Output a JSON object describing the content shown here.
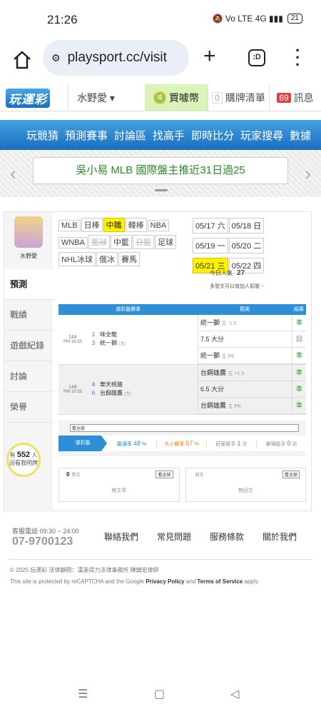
{
  "status": {
    "time": "21:26",
    "icons": "🔕 Vo LTE 4G ▮▮▮",
    "battery": "21"
  },
  "browser": {
    "url": "playsport.cc/visit",
    "tabs_label": ":D"
  },
  "site": {
    "logo": "玩運彩",
    "user": "水野愛 ▾",
    "buy": "買噱幣",
    "cart_count": "0",
    "cart": "購牌清單",
    "msg_count": "69",
    "msg": "訊息"
  },
  "nav": [
    "玩競猜",
    "預測賽事",
    "討論區",
    "找高手",
    "即時比分",
    "玩家搜尋",
    "數據"
  ],
  "banner": {
    "text": "吳小易 MLB 國際盤主推近31日過25"
  },
  "profile": {
    "name": "水野愛",
    "avatar_alt": "avatar"
  },
  "side": [
    "預測",
    "戰績",
    "遊戲紀錄",
    "討論",
    "榮譽"
  ],
  "helped": {
    "pre": "有",
    "count": "552",
    "mid": "人",
    "post": "因看我明牌"
  },
  "sports": [
    {
      "label": "MLB",
      "state": ""
    },
    {
      "label": "日棒",
      "state": ""
    },
    {
      "label": "中職",
      "state": "sel"
    },
    {
      "label": "韓棒",
      "state": ""
    },
    {
      "label": "NBA",
      "state": ""
    },
    {
      "label": "WNBA",
      "state": ""
    },
    {
      "label": "籃球",
      "state": "dis"
    },
    {
      "label": "中籃",
      "state": ""
    },
    {
      "label": "日籃",
      "state": "dis"
    },
    {
      "label": "足球",
      "state": ""
    },
    {
      "label": "NHL冰球",
      "state": ""
    },
    {
      "label": "俄冰",
      "state": ""
    },
    {
      "label": "賽馬",
      "state": ""
    }
  ],
  "dates": [
    {
      "d": "05/17",
      "w": "六",
      "state": ""
    },
    {
      "d": "05/18",
      "w": "日",
      "state": ""
    },
    {
      "d": "05/19",
      "w": "一",
      "state": ""
    },
    {
      "d": "05/20",
      "w": "二",
      "state": ""
    },
    {
      "d": "05/21",
      "w": "三",
      "state": "sel"
    },
    {
      "d": "05/22",
      "w": "四",
      "state": ""
    }
  ],
  "popularity": {
    "label": "今日人氣",
    "value": "27",
    "hint": "多發文可以增加人氣喔 ~"
  },
  "table": {
    "h_game": "運彩盤賽事",
    "h_pick": "預測",
    "h_res": "結果"
  },
  "games": [
    {
      "no": "144",
      "time": "PM 18:35",
      "t1n": "1",
      "t1": "味全龍",
      "t2n": "3",
      "t2": "統一獅",
      "t2tag": "(主)",
      "picks": [
        {
          "a": "統一獅",
          "b": "主 -1.5",
          "r": "準",
          "g": false
        },
        {
          "a": "7.5 大分",
          "b": "",
          "r": "囧",
          "g": true
        },
        {
          "a": "統一獅",
          "b": "主 PK",
          "r": "準",
          "g": false
        }
      ]
    },
    {
      "no": "146",
      "time": "PM 18:35",
      "t1n": "4",
      "t1": "樂天桃猿",
      "t2n": "6",
      "t2": "台鋼雄鷹",
      "t2tag": "(主)",
      "picks": [
        {
          "a": "台鋼雄鷹",
          "b": "主 +1.5",
          "r": "準",
          "g": false
        },
        {
          "a": "6.5 大分",
          "b": "",
          "r": "準",
          "g": false
        },
        {
          "a": "台鋼雄鷹",
          "b": "主 PK",
          "r": "準",
          "g": false
        }
      ]
    }
  ],
  "stats": {
    "title": "戰績",
    "more": "看全部",
    "label": "運彩盤",
    "c1": "贏讓率",
    "v1": "48",
    "c2": "大小勝率",
    "v2": "57",
    "c3": "莊家殺手",
    "v3": "1",
    "c4": "單場殺手",
    "v4": "0",
    "pct": "%",
    "times": "次"
  },
  "posts": [
    {
      "count": "0",
      "label": "發文",
      "more": "看全部",
      "empty": "無文章"
    },
    {
      "count": "",
      "label": "回文",
      "more": "看全部",
      "empty": "無回文"
    }
  ],
  "footer": {
    "support": "客服電話 09:30 ~ 24:00",
    "phone": "07-9700123",
    "links": [
      "聯絡我們",
      "常見問題",
      "服務條款",
      "關於我們"
    ],
    "copyright": "© 2025 玩運彩  法律顧問：漢英得力法律事務所 陳鎮宏律師",
    "recap_pre": "This site is protected by reCAPTCHA and the Google ",
    "pp": "Privacy Policy",
    "and": " and ",
    "tos": "Terms of Service",
    "recap_post": " apply."
  },
  "sysnav": {
    "menu": "☰",
    "home": "▢",
    "back": "◁"
  }
}
